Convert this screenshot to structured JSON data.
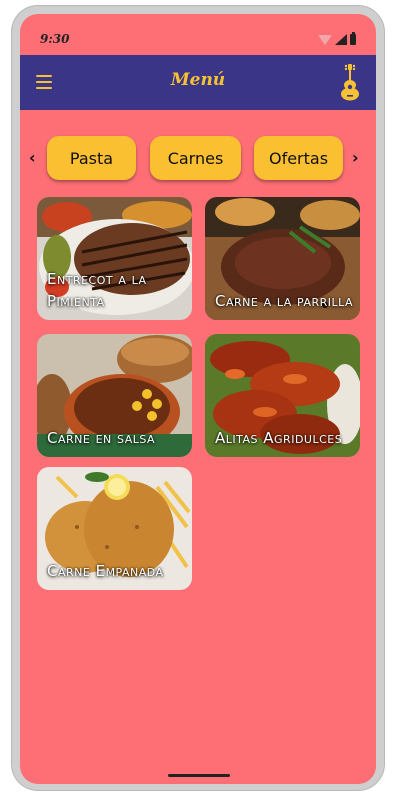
{
  "status_bar": {
    "time": "9:30"
  },
  "app_bar": {
    "title": "Menú",
    "menu_icon": "hamburger-menu-icon",
    "logo_icon": "guitar-icon"
  },
  "categories": {
    "prev_arrow": "‹",
    "next_arrow": "›",
    "items": [
      {
        "label": "Pasta"
      },
      {
        "label": "Carnes"
      },
      {
        "label": "Ofertas"
      }
    ]
  },
  "dishes": [
    {
      "name": "Entrecot a la Pimienta"
    },
    {
      "name": "Carne a la parrilla"
    },
    {
      "name": "Carne en salsa"
    },
    {
      "name": "Alitas Agridulces"
    },
    {
      "name": "Carne Empanada"
    }
  ],
  "colors": {
    "background": "#fd6f75",
    "app_bar": "#3b3587",
    "accent": "#f6c233",
    "chip": "#fbbf32"
  }
}
